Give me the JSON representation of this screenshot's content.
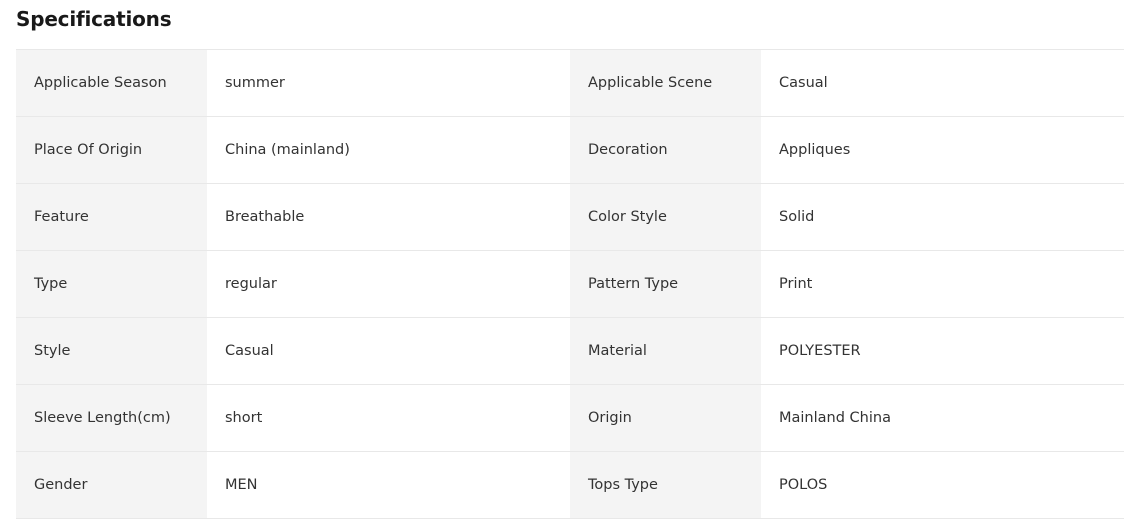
{
  "section": {
    "title": "Specifications"
  },
  "specs": [
    {
      "left_name": "Applicable Season",
      "left_value": "summer",
      "right_name": "Applicable Scene",
      "right_value": "Casual"
    },
    {
      "left_name": "Place Of Origin",
      "left_value": "China (mainland)",
      "right_name": "Decoration",
      "right_value": "Appliques"
    },
    {
      "left_name": "Feature",
      "left_value": "Breathable",
      "right_name": "Color Style",
      "right_value": "Solid"
    },
    {
      "left_name": "Type",
      "left_value": "regular",
      "right_name": "Pattern Type",
      "right_value": "Print"
    },
    {
      "left_name": "Style",
      "left_value": "Casual",
      "right_name": "Material",
      "right_value": "POLYESTER"
    },
    {
      "left_name": "Sleeve Length(cm)",
      "left_value": "short",
      "right_name": "Origin",
      "right_value": "Mainland China"
    },
    {
      "left_name": "Gender",
      "left_value": "MEN",
      "right_name": "Tops Type",
      "right_value": "POLOS"
    }
  ],
  "colors": {
    "key_background": "#f4f4f4",
    "value_background": "#ffffff",
    "border": "#e8e8e8",
    "text": "#333333",
    "title": "#191919"
  }
}
